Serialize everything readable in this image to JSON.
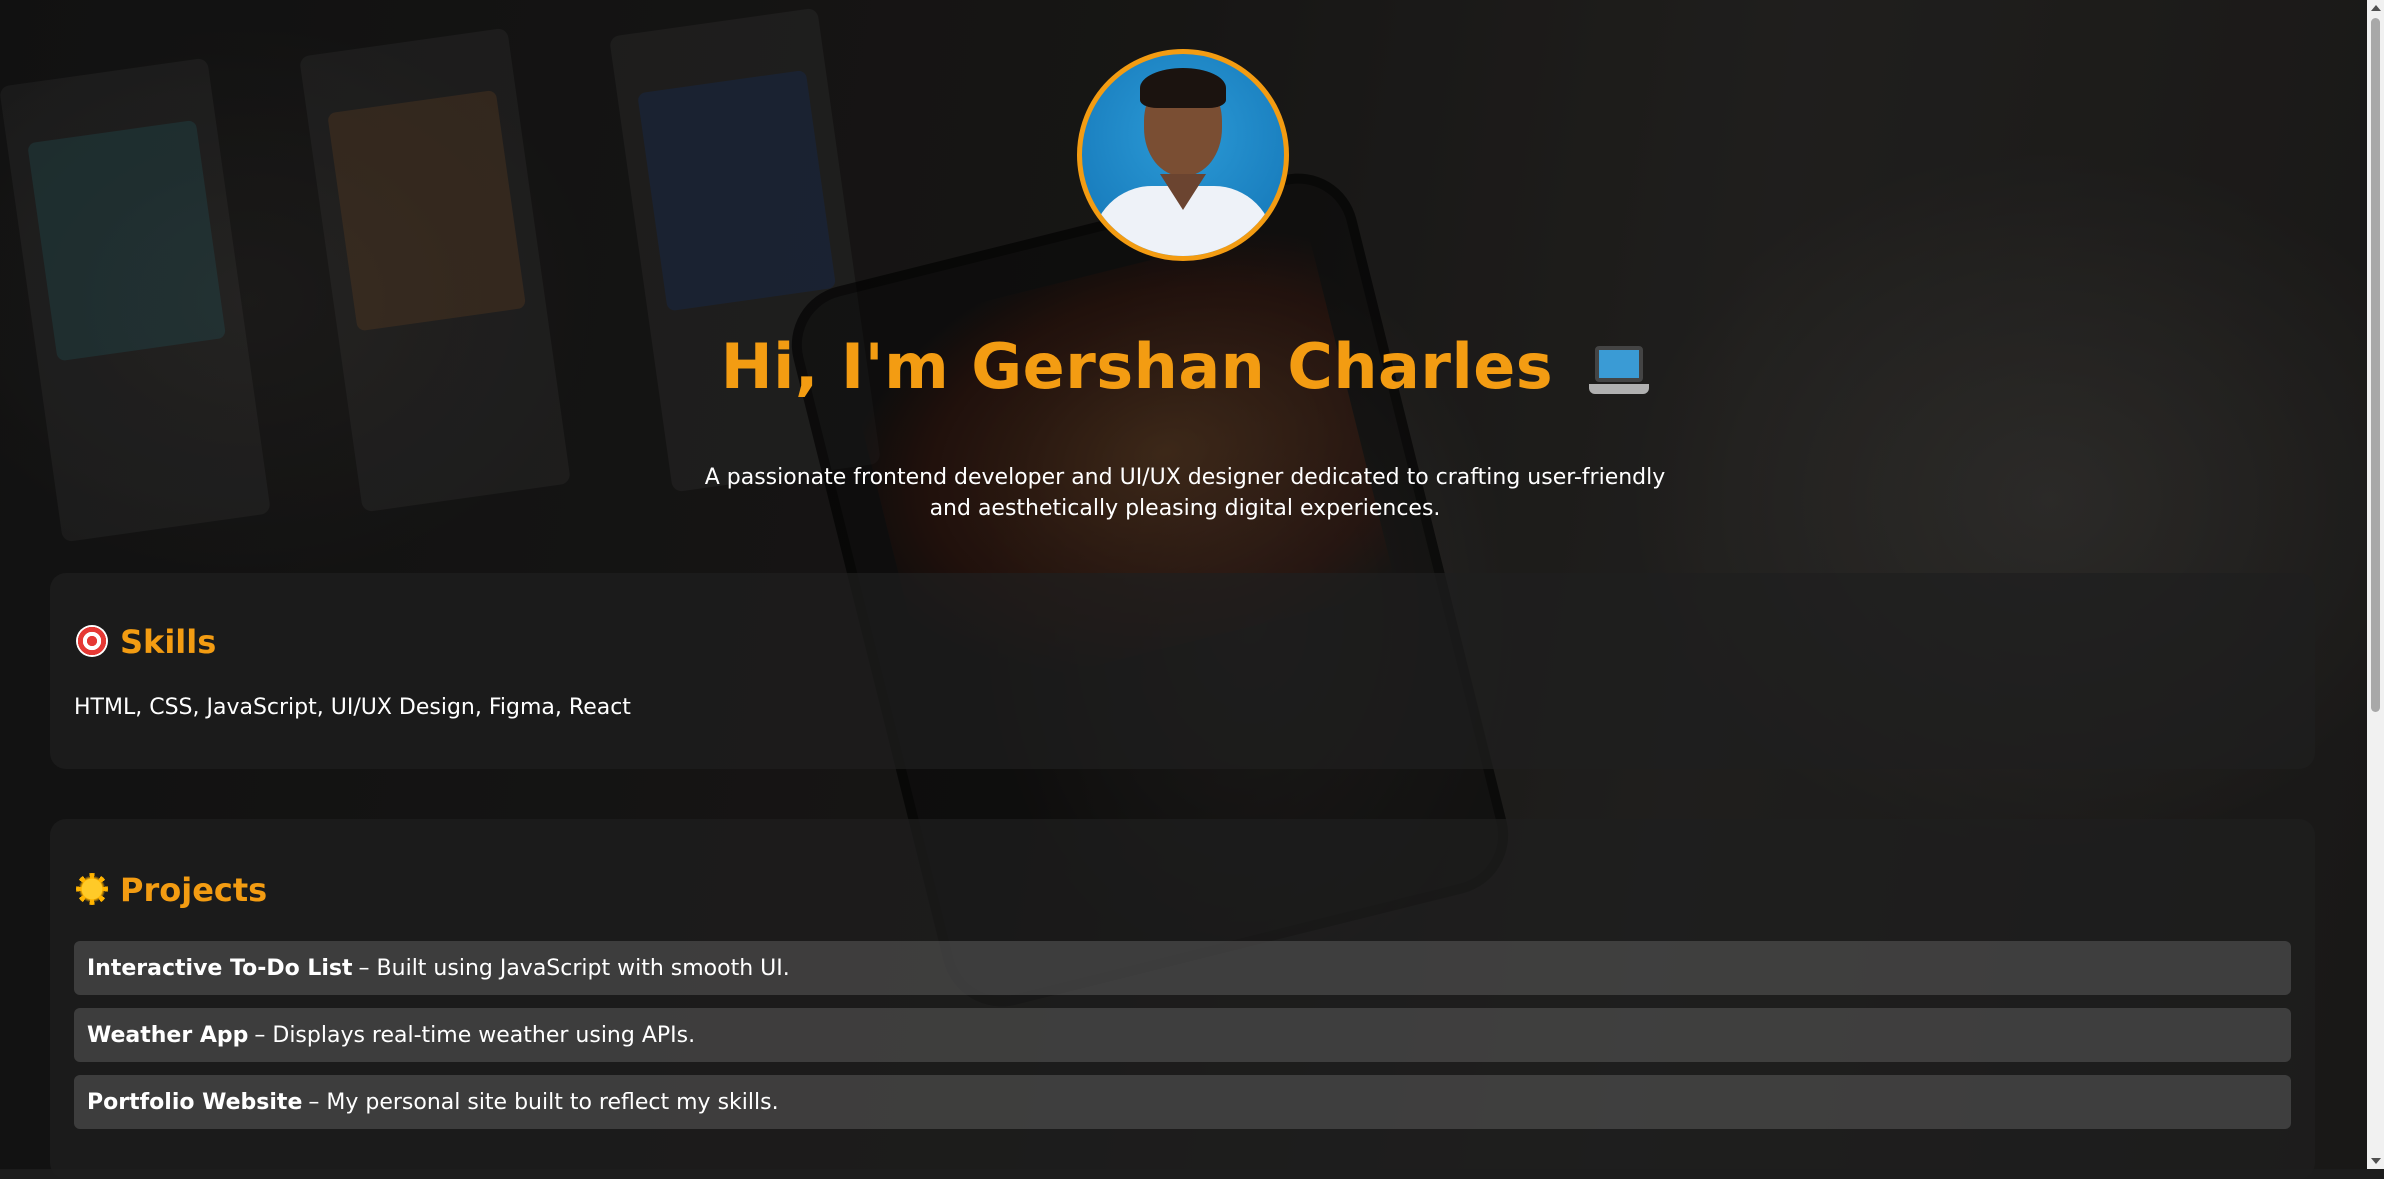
{
  "hero": {
    "title": "Hi, I'm Gershan Charles",
    "title_icon": "laptop-icon",
    "subtitle": "A passionate frontend developer and UI/UX designer dedicated to crafting user-friendly and aesthetically pleasing digital experiences."
  },
  "skills": {
    "heading": "Skills",
    "icon": "target-icon",
    "text": "HTML, CSS, JavaScript, UI/UX Design, Figma, React"
  },
  "projects": {
    "heading": "Projects",
    "icon": "sun-icon",
    "items": [
      {
        "name": "Interactive To-Do List",
        "desc": "– Built using JavaScript with smooth UI."
      },
      {
        "name": "Weather App",
        "desc": "– Displays real-time weather using APIs."
      },
      {
        "name": "Portfolio Website",
        "desc": "– My personal site built to reflect my skills."
      }
    ]
  },
  "colors": {
    "accent": "#f39c12",
    "section_bg": "#1e1e1e",
    "project_bg": "#555555"
  }
}
